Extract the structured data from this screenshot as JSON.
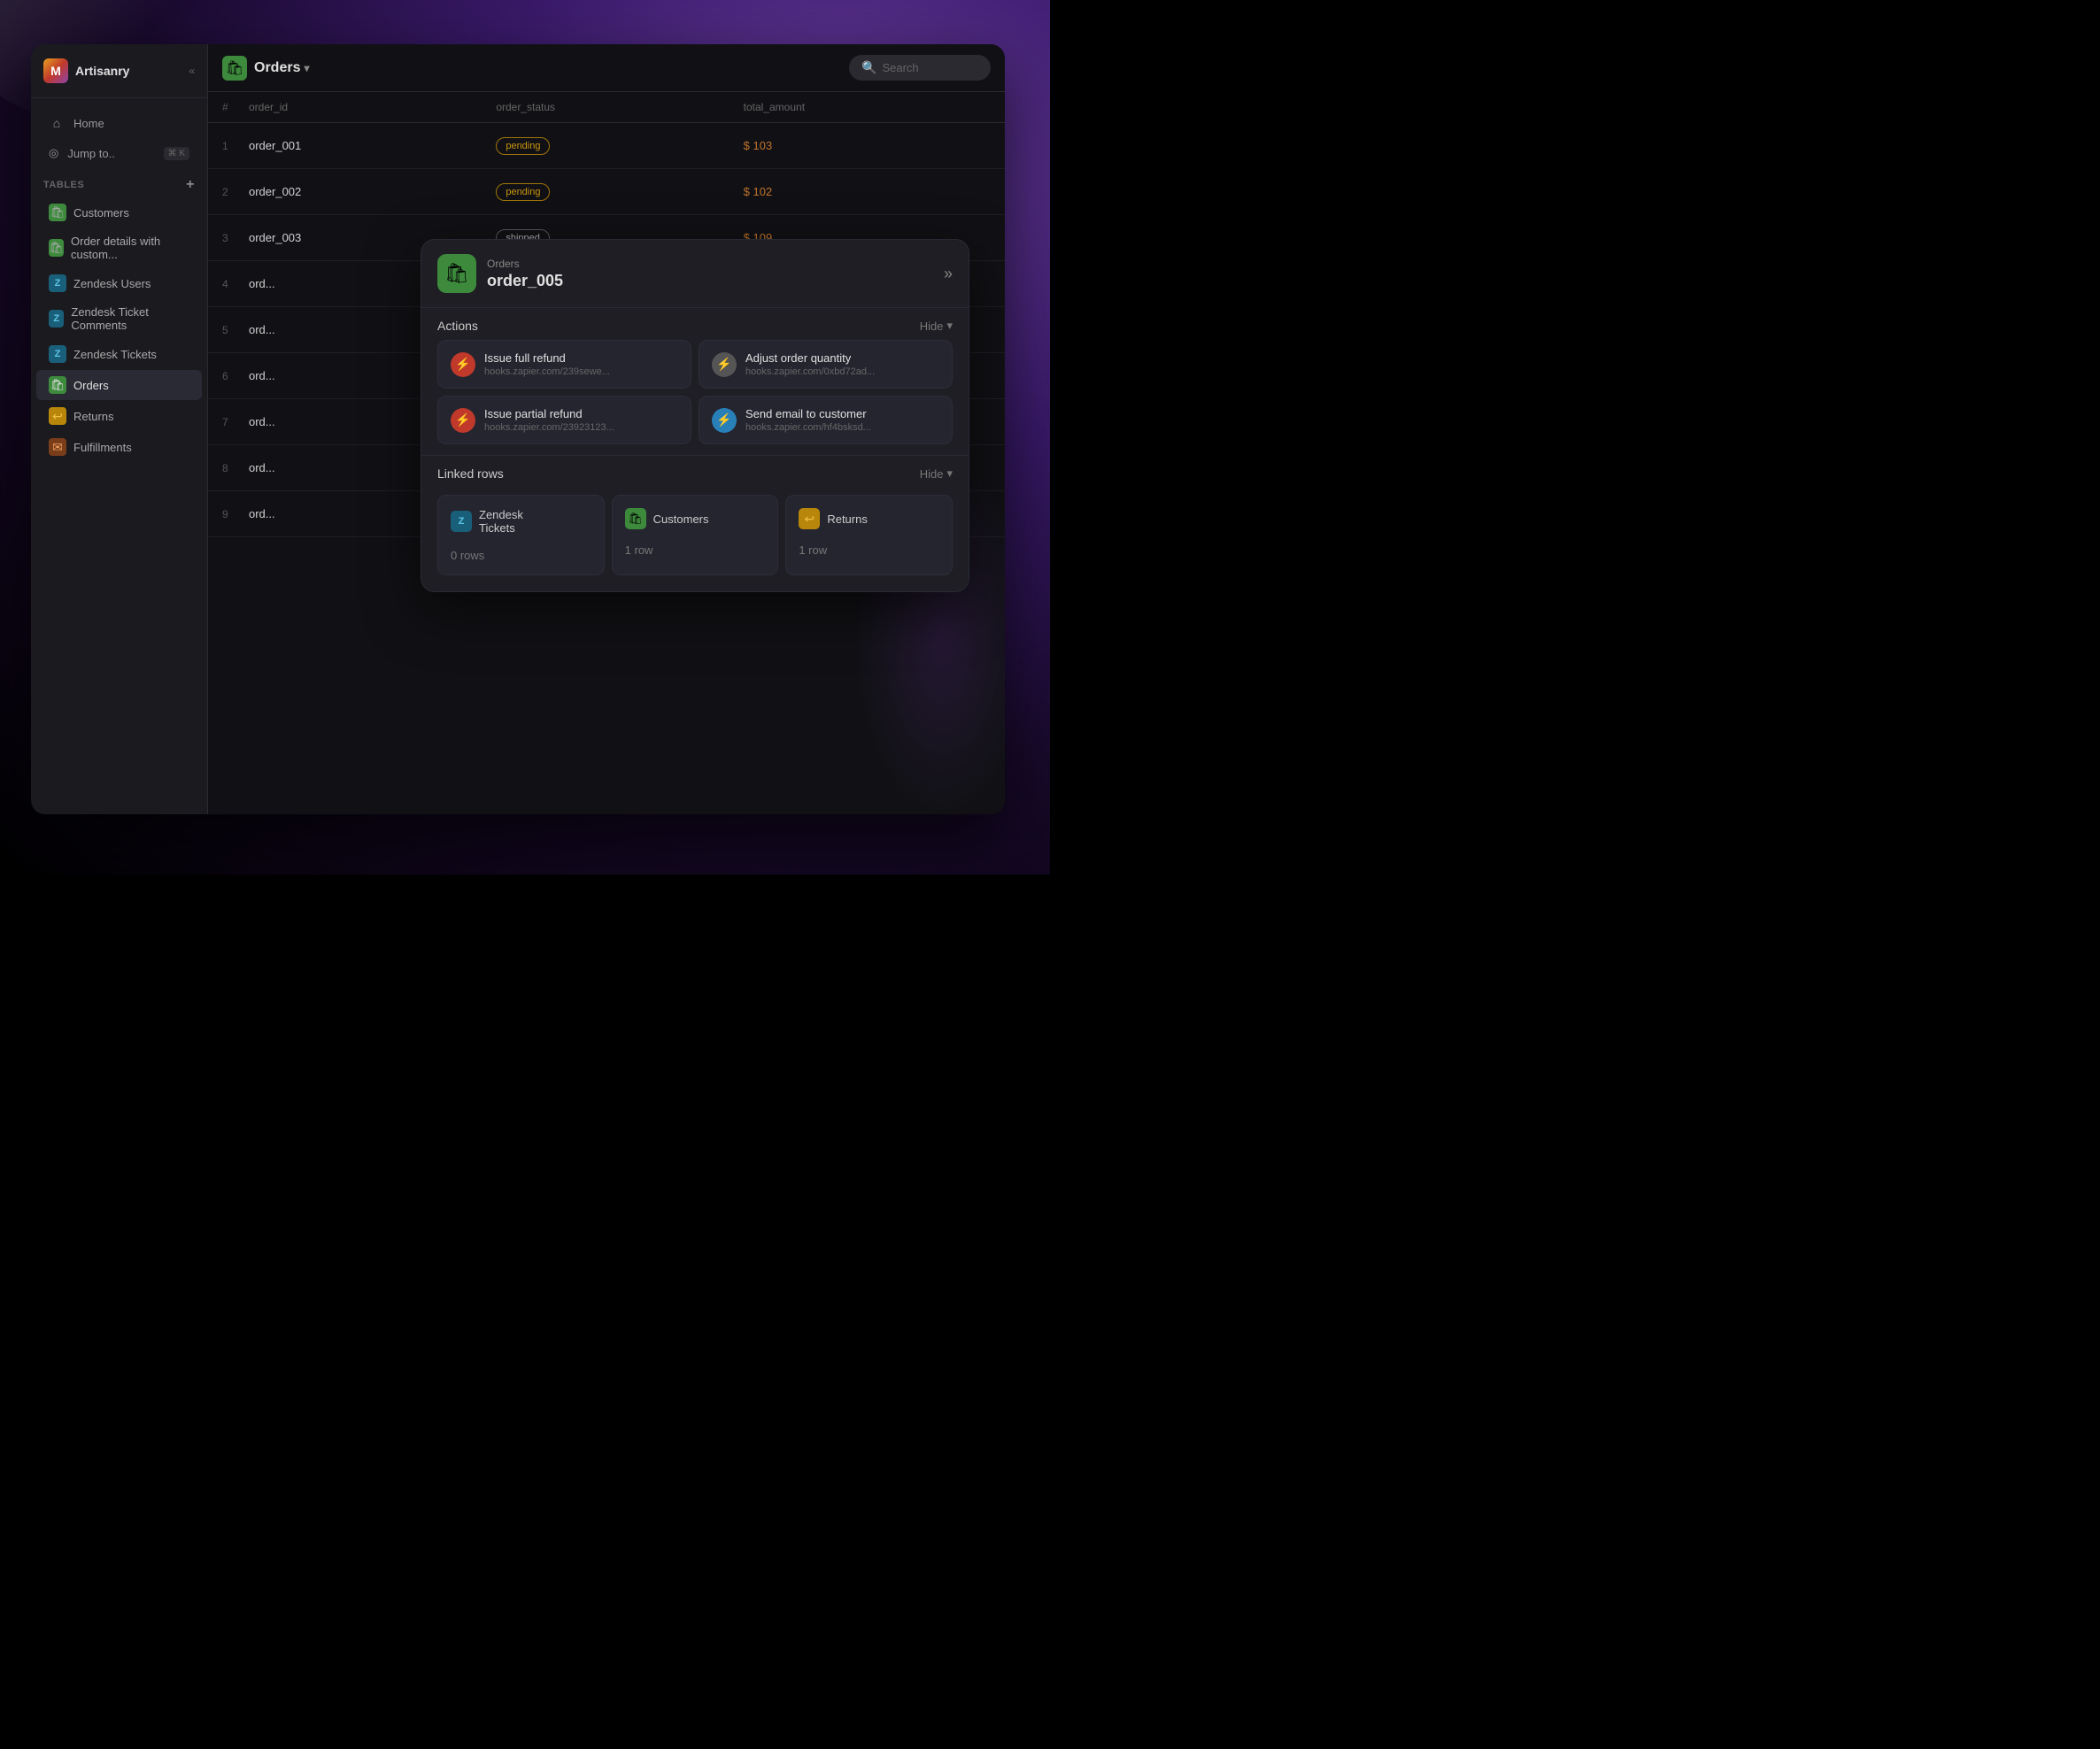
{
  "app": {
    "brand": "Artisanry",
    "brand_initial": "M"
  },
  "sidebar": {
    "collapse_icon": "«",
    "nav_items": [
      {
        "id": "home",
        "label": "Home",
        "icon": "⌂"
      },
      {
        "id": "jump",
        "label": "Jump to..",
        "icon": "◎",
        "shortcut": "⌘ K"
      }
    ],
    "tables_label": "Tables",
    "add_icon": "+",
    "table_items": [
      {
        "id": "customers",
        "label": "Customers",
        "icon": "🛍",
        "icon_class": "icon-shopify",
        "active": false
      },
      {
        "id": "order-details",
        "label": "Order details with custom...",
        "icon": "🛍",
        "icon_class": "icon-shopify",
        "active": false
      },
      {
        "id": "zendesk-users",
        "label": "Zendesk Users",
        "icon": "Z",
        "icon_class": "icon-zendesk",
        "active": false
      },
      {
        "id": "zendesk-ticket-comments",
        "label": "Zendesk Ticket Comments",
        "icon": "Z",
        "icon_class": "icon-zendesk",
        "active": false
      },
      {
        "id": "zendesk-tickets",
        "label": "Zendesk Tickets",
        "icon": "Z",
        "icon_class": "icon-zendesk",
        "active": false
      },
      {
        "id": "orders",
        "label": "Orders",
        "icon": "🛍",
        "icon_class": "icon-shopify",
        "active": true
      },
      {
        "id": "returns",
        "label": "Returns",
        "icon": "↩",
        "icon_class": "icon-returns",
        "active": false
      },
      {
        "id": "fulfillments",
        "label": "Fulfillments",
        "icon": "✉",
        "icon_class": "icon-fulfillments",
        "active": false
      }
    ]
  },
  "topbar": {
    "table_name": "Orders",
    "dropdown_icon": "▾",
    "search_placeholder": "Search"
  },
  "table": {
    "columns": [
      "order_id",
      "order_status",
      "total_amount"
    ],
    "rows": [
      {
        "num": "1",
        "order_id": "order_001",
        "status": "pending",
        "status_type": "pending",
        "amount": "$ 103"
      },
      {
        "num": "2",
        "order_id": "order_002",
        "status": "pending",
        "status_type": "pending",
        "amount": "$ 102"
      },
      {
        "num": "3",
        "order_id": "order_003",
        "status": "shipped",
        "status_type": "shipped",
        "amount": "$ 109"
      },
      {
        "num": "4",
        "order_id": "ord...",
        "status": "",
        "status_type": "",
        "amount": ""
      },
      {
        "num": "5",
        "order_id": "ord...",
        "status": "",
        "status_type": "",
        "amount": ""
      },
      {
        "num": "6",
        "order_id": "ord...",
        "status": "",
        "status_type": "",
        "amount": ""
      },
      {
        "num": "7",
        "order_id": "ord...",
        "status": "",
        "status_type": "",
        "amount": ""
      },
      {
        "num": "8",
        "order_id": "ord...",
        "status": "",
        "status_type": "",
        "amount": ""
      },
      {
        "num": "9",
        "order_id": "ord...",
        "status": "",
        "status_type": "",
        "amount": ""
      }
    ]
  },
  "popup": {
    "app_name": "Orders",
    "record_name": "order_005",
    "expand_icon": "»",
    "actions_label": "Actions",
    "hide_label": "Hide",
    "hide_icon": "▾",
    "actions": [
      {
        "id": "full-refund",
        "name": "Issue full refund",
        "url": "hooks.zapier.com/239sewe...",
        "icon": "⚡",
        "icon_class": "icon-red"
      },
      {
        "id": "adjust-quantity",
        "name": "Adjust order quantity",
        "url": "hooks.zapier.com/0xbd72ad...",
        "icon": "⚡",
        "icon_class": "icon-gray"
      },
      {
        "id": "partial-refund",
        "name": "Issue partial refund",
        "url": "hooks.zapier.com/23923123...",
        "icon": "⚡",
        "icon_class": "icon-red"
      },
      {
        "id": "send-email",
        "name": "Send email to customer",
        "url": "hooks.zapier.com/hf4bsksd...",
        "icon": "⚡",
        "icon_class": "icon-blue"
      }
    ],
    "linked_rows_label": "Linked rows",
    "linked_rows_hide_label": "Hide",
    "linked_rows_hide_icon": "▾",
    "linked": [
      {
        "id": "zendesk-tickets",
        "name": "Zendesk\nTickets",
        "name_line1": "Zendesk",
        "name_line2": "Tickets",
        "count": "0 rows",
        "icon": "Z",
        "icon_class": "icon-zendesk"
      },
      {
        "id": "customers",
        "name": "Customers",
        "count": "1 row",
        "icon": "🛍",
        "icon_class": "icon-shopify"
      },
      {
        "id": "returns",
        "name": "Returns",
        "count": "1 row",
        "icon": "↩",
        "icon_class": "icon-returns"
      }
    ]
  }
}
